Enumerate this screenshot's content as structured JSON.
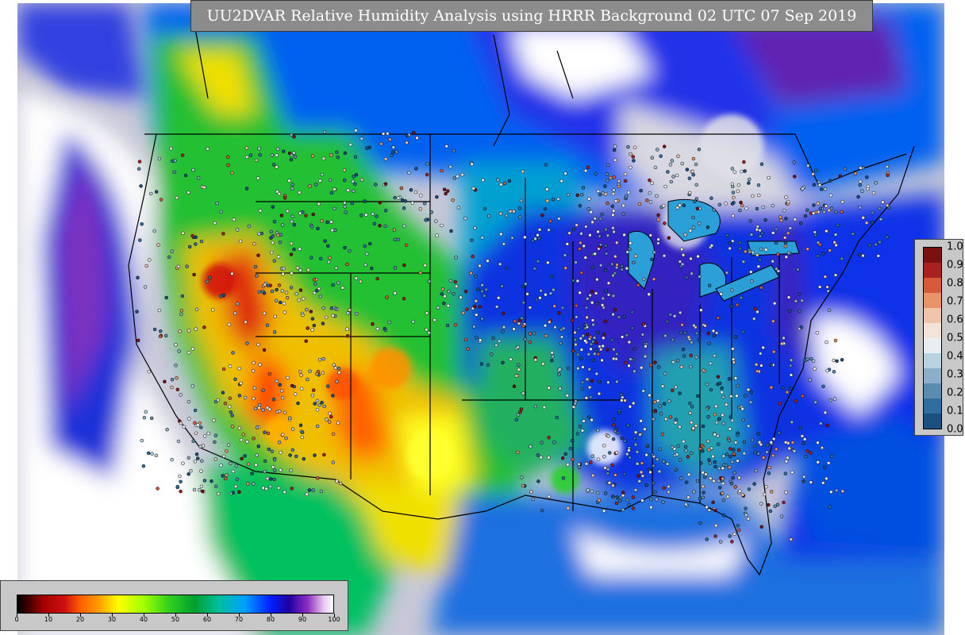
{
  "title": "UU2DVAR Relative Humidity Analysis using HRRR Background 02 UTC 07 Sep 2019",
  "station_colorbar": {
    "labels": [
      "0.0",
      "0.1",
      "0.2",
      "0.3",
      "0.4",
      "0.5",
      "0.6",
      "0.7",
      "0.8",
      "0.9",
      "1.0"
    ],
    "colors": [
      "#1a4f80",
      "#2f6f9f",
      "#5b8cb0",
      "#8cafc9",
      "#b8d2e1",
      "#e8eef2",
      "#f2e2d8",
      "#f1c3ab",
      "#e8946b",
      "#d65a3a",
      "#a82020",
      "#7a1010"
    ]
  },
  "rh_colorbar": {
    "labels": [
      "0",
      "10",
      "20",
      "30",
      "40",
      "50",
      "60",
      "70",
      "80",
      "90",
      "100"
    ],
    "stops": [
      {
        "v": 0,
        "c": "#000000"
      },
      {
        "v": 4,
        "c": "#4a0000"
      },
      {
        "v": 8,
        "c": "#a00000"
      },
      {
        "v": 15,
        "c": "#d01010"
      },
      {
        "v": 20,
        "c": "#ff6000"
      },
      {
        "v": 26,
        "c": "#ffa000"
      },
      {
        "v": 32,
        "c": "#ffff00"
      },
      {
        "v": 40,
        "c": "#a0ff00"
      },
      {
        "v": 48,
        "c": "#30d020"
      },
      {
        "v": 56,
        "c": "#00a030"
      },
      {
        "v": 64,
        "c": "#00c0a0"
      },
      {
        "v": 72,
        "c": "#00a0ff"
      },
      {
        "v": 80,
        "c": "#0020ff"
      },
      {
        "v": 86,
        "c": "#2000a0"
      },
      {
        "v": 92,
        "c": "#9030c0"
      },
      {
        "v": 97,
        "c": "#e8c8f0"
      },
      {
        "v": 100,
        "c": "#ffffff"
      }
    ]
  },
  "map_colors": {
    "ocean_moist": "#0018c8",
    "saturated": "#c8c8d8",
    "dry_west": "#f0e000",
    "very_dry": "#e02010",
    "mid": "#20c030"
  }
}
